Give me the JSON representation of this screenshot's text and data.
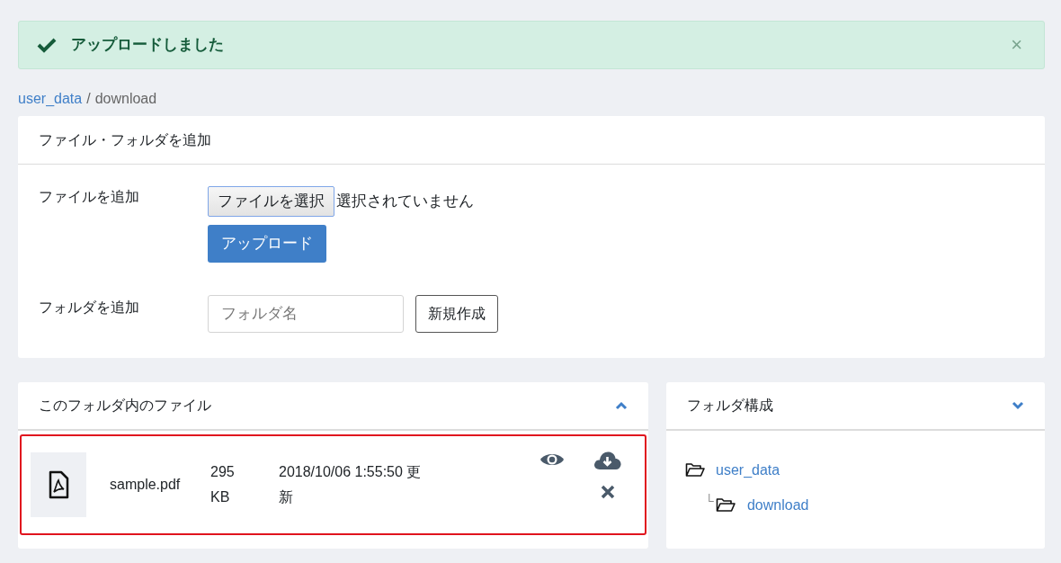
{
  "alert": {
    "message": "アップロードしました",
    "close": "×"
  },
  "breadcrumb": [
    {
      "label": "user_data",
      "link": true
    },
    {
      "label": "/",
      "link": false
    },
    {
      "label": "download",
      "link": false
    }
  ],
  "add_panel": {
    "title": "ファイル・フォルダを追加",
    "file_row": {
      "label": "ファイルを追加",
      "choose_button": "ファイルを選択",
      "no_file": "選択されていません",
      "upload_button": "アップロード"
    },
    "folder_row": {
      "label": "フォルダを追加",
      "placeholder": "フォルダ名",
      "create_button": "新規作成"
    }
  },
  "files_panel": {
    "title": "このフォルダ内のファイル",
    "files": [
      {
        "name": "sample.pdf",
        "size": "295 KB",
        "updated": "2018/10/06 1:55:50 更新",
        "highlighted": true
      }
    ]
  },
  "tree_panel": {
    "title": "フォルダ構成",
    "tree": [
      {
        "label": "user_data",
        "children": [
          {
            "connector": "└",
            "label": "download"
          }
        ]
      }
    ]
  }
}
